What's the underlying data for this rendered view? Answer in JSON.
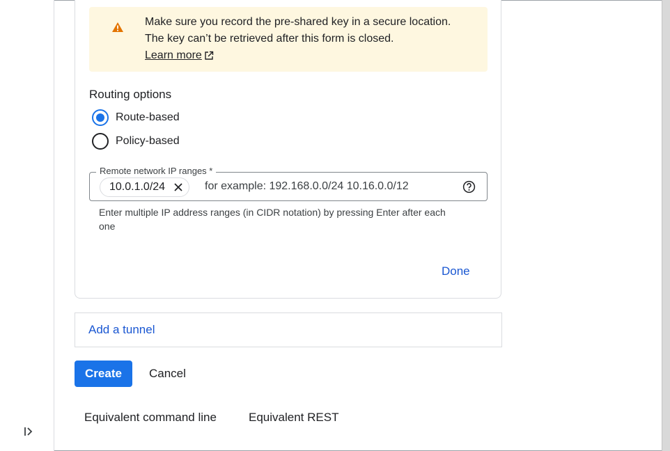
{
  "warning": {
    "line1": "Make sure you record the pre-shared key in a secure location.",
    "line2": "The key can’t be retrieved after this form is closed.",
    "learn_more": "Learn more",
    "icon": "warning-icon",
    "color": "#e37400"
  },
  "routing": {
    "title": "Routing options",
    "options": [
      {
        "label": "Route-based",
        "selected": true
      },
      {
        "label": "Policy-based",
        "selected": false
      }
    ]
  },
  "remote_ranges": {
    "label": "Remote network IP ranges *",
    "chips": [
      "10.0.1.0/24"
    ],
    "placeholder": "for example: 192.168.0.0/24 10.16.0.0/12",
    "helper": "Enter multiple IP address ranges (in CIDR notation) by pressing Enter after each one"
  },
  "actions": {
    "done": "Done",
    "add_tunnel": "Add a tunnel",
    "create": "Create",
    "cancel": "Cancel",
    "equivalent_cli": "Equivalent command line",
    "equivalent_rest": "Equivalent REST"
  },
  "colors": {
    "accent": "#1a73e8",
    "link": "#1a57d2",
    "warning_bg": "#fef7e0"
  }
}
